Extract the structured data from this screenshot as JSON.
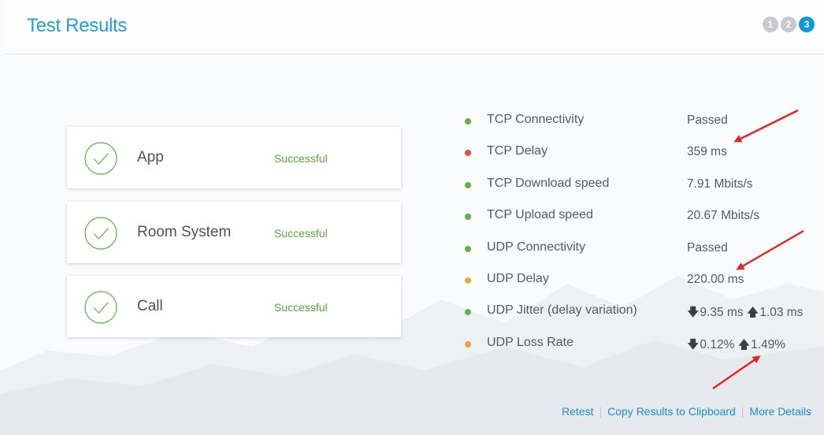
{
  "header": {
    "title": "Test Results",
    "steps": [
      "1",
      "2",
      "3"
    ],
    "active_step": 3
  },
  "cards": [
    {
      "name": "App",
      "status": "Successful",
      "icon": "check-circle-icon"
    },
    {
      "name": "Room System",
      "status": "Successful",
      "icon": "check-circle-icon"
    },
    {
      "name": "Call",
      "status": "Successful",
      "icon": "check-circle-icon"
    }
  ],
  "results": [
    {
      "label": "TCP Connectivity",
      "status": "green",
      "value": "Passed"
    },
    {
      "label": "TCP Delay",
      "status": "red",
      "value": "359 ms"
    },
    {
      "label": "TCP Download speed",
      "status": "green",
      "value": "7.91 Mbits/s"
    },
    {
      "label": "TCP Upload speed",
      "status": "green",
      "value": "20.67 Mbits/s"
    },
    {
      "label": "UDP Connectivity",
      "status": "green",
      "value": "Passed"
    },
    {
      "label": "UDP Delay",
      "status": "orange",
      "value": "220.00 ms"
    },
    {
      "label": "UDP Jitter (delay variation)",
      "status": "green",
      "down": "9.35 ms",
      "up": "1.03 ms"
    },
    {
      "label": "UDP Loss Rate",
      "status": "orange",
      "down": "0.12%",
      "up": "1.49%"
    }
  ],
  "footer": {
    "retest": "Retest",
    "copy": "Copy Results to Clipboard",
    "details": "More Details"
  },
  "colors": {
    "accent": "#1fa0d8",
    "success": "#57a63b",
    "green": "#63b044",
    "red": "#d9534f",
    "orange": "#f0a33a",
    "annotation": "#e8231f"
  }
}
